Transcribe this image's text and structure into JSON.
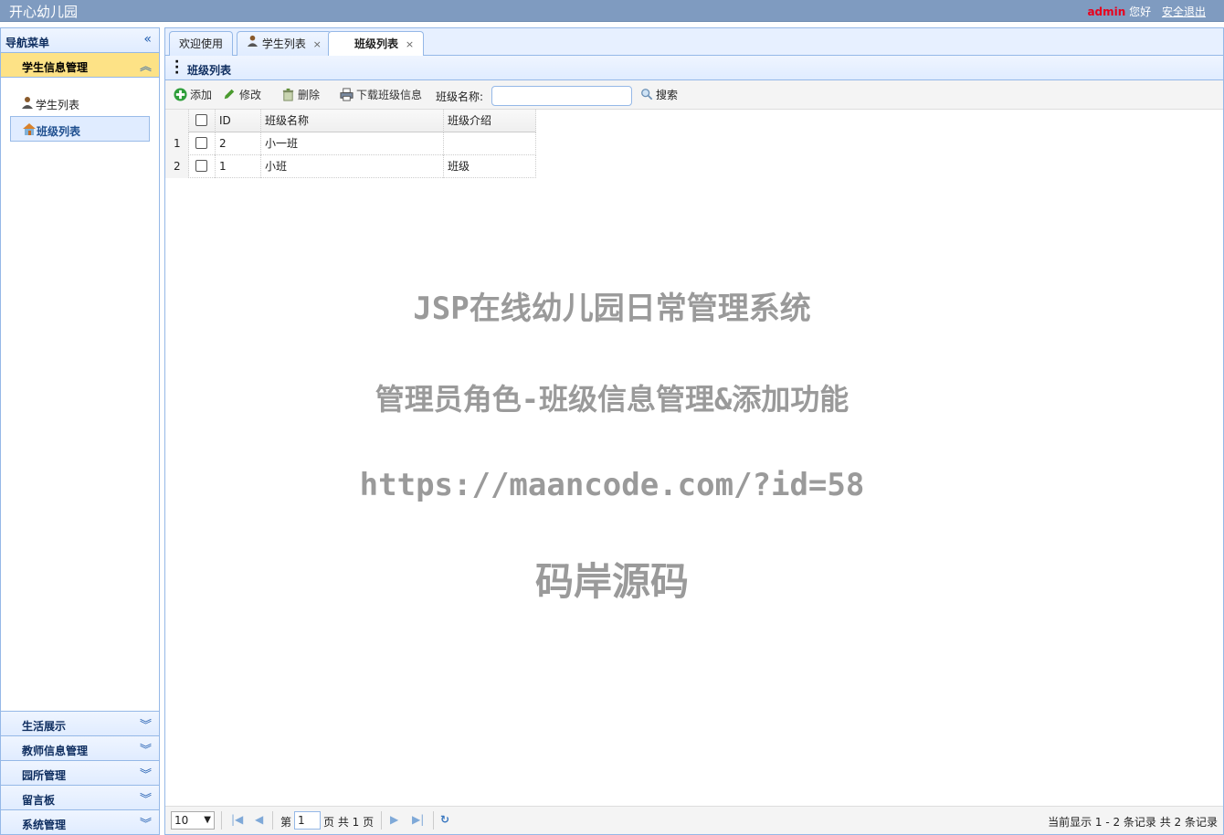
{
  "header": {
    "title": "开心幼儿园",
    "username": "admin",
    "greeting": "您好",
    "logout": "安全退出"
  },
  "sidebar": {
    "title": "导航菜单",
    "open_section": "学生信息管理",
    "items": [
      {
        "label": "学生列表",
        "icon": "user-icon"
      },
      {
        "label": "班级列表",
        "icon": "house-icon"
      }
    ],
    "sections": [
      "生活展示",
      "教师信息管理",
      "园所管理",
      "留言板",
      "系统管理"
    ]
  },
  "tabs": [
    {
      "label": "欢迎使用",
      "closable": false
    },
    {
      "label": "学生列表",
      "closable": true
    },
    {
      "label": "班级列表",
      "closable": true
    }
  ],
  "panel": {
    "title": "班级列表"
  },
  "toolbar": {
    "add": "添加",
    "edit": "修改",
    "delete": "删除",
    "download": "下载班级信息",
    "search_label": "班级名称:",
    "search_placeholder": "",
    "search": "搜索"
  },
  "grid": {
    "columns": [
      "ID",
      "班级名称",
      "班级介绍"
    ],
    "rows": [
      {
        "rownum": "1",
        "id": "2",
        "name": "小一班",
        "intro": ""
      },
      {
        "rownum": "2",
        "id": "1",
        "name": "小班",
        "intro": "班级"
      }
    ]
  },
  "watermark": {
    "line1": "JSP在线幼儿园日常管理系统",
    "line2": "管理员角色-班级信息管理&添加功能",
    "line3": "https://maancode.com/?id=58",
    "line4": "码岸源码"
  },
  "pager": {
    "page_size": "10",
    "page_prefix": "第",
    "page_value": "1",
    "page_suffix": "页 共 1 页",
    "info": "当前显示 1 - 2 条记录 共 2 条记录"
  }
}
